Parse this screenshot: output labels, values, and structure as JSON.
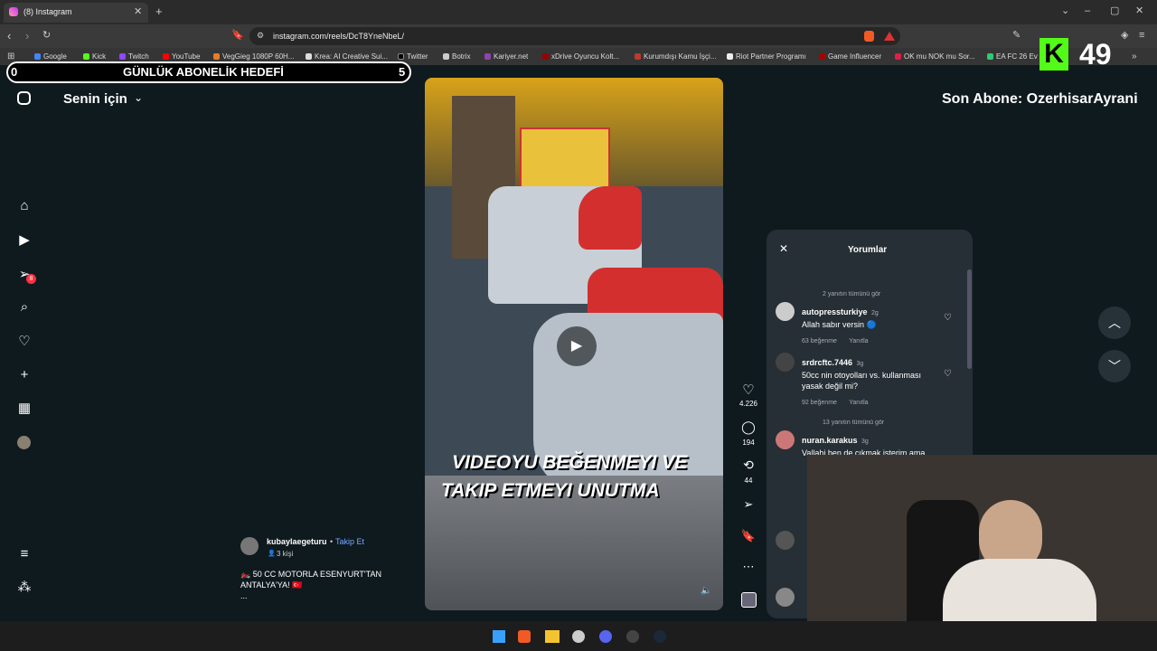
{
  "browser": {
    "tab_title": "(8) Instagram",
    "url": "instagram.com/reels/DcT8YneNbeL/",
    "bookmarks": [
      "Google",
      "Kick",
      "Twitch",
      "YouTube",
      "VegGieg 1080P 60H...",
      "Krea: AI Creative Sui...",
      "Twitter",
      "Botrix",
      "Kariyer.net",
      "xDrive Oyuncu Kolt...",
      "Kurumdışı Kamu İşçi...",
      "Riot Partner Programı",
      "Game Influencer",
      "OK mu NOK mu Sor...",
      "EA FC 26 Ev"
    ]
  },
  "overlay": {
    "goal_start": "0",
    "goal_label": "GÜNLÜK ABONELİK HEDEFİ",
    "goal_end": "5",
    "kick_count": "49",
    "last_sub": "Son Abone: OzerhisarAyrani"
  },
  "instagram": {
    "feed_label": "Senin için",
    "notification_badge": "8",
    "post": {
      "username": "kubaylaegeturu",
      "follow": "Takip Et",
      "people": "3 kişi",
      "caption": "🏍️ 50 CC MOTORLA ESENYURT'TAN ANTALYA'YA! 🇹🇷",
      "more": "...",
      "video_text_1": "VIDEOYU BEĞENMEYI VE",
      "video_text_2": "TAKIP ETMEYI UNUTMA"
    },
    "actions": {
      "likes": "4.226",
      "comments": "194",
      "reposts": "44"
    },
    "comments_panel": {
      "title": "Yorumlar",
      "see_replies_1": "2 yanıtın tümünü gör",
      "see_replies_2": "13 yanıtın tümünü gör",
      "items": [
        {
          "user": "autopressturkiye",
          "time": "2g",
          "text": "Allah sabır versin 🔵",
          "likes": "63 beğenme",
          "reply": "Yanıtla"
        },
        {
          "user": "srdrcftc.7446",
          "time": "3g",
          "text": "50cc nin otoyolları vs. kullanması yasak değil mi?",
          "likes": "92 beğenme",
          "reply": "Yanıtla"
        },
        {
          "user": "nuran.karakus",
          "time": "3g",
          "text": "Vallahi ben de çıkmak isterim ama",
          "likes": "",
          "reply": ""
        }
      ]
    }
  }
}
